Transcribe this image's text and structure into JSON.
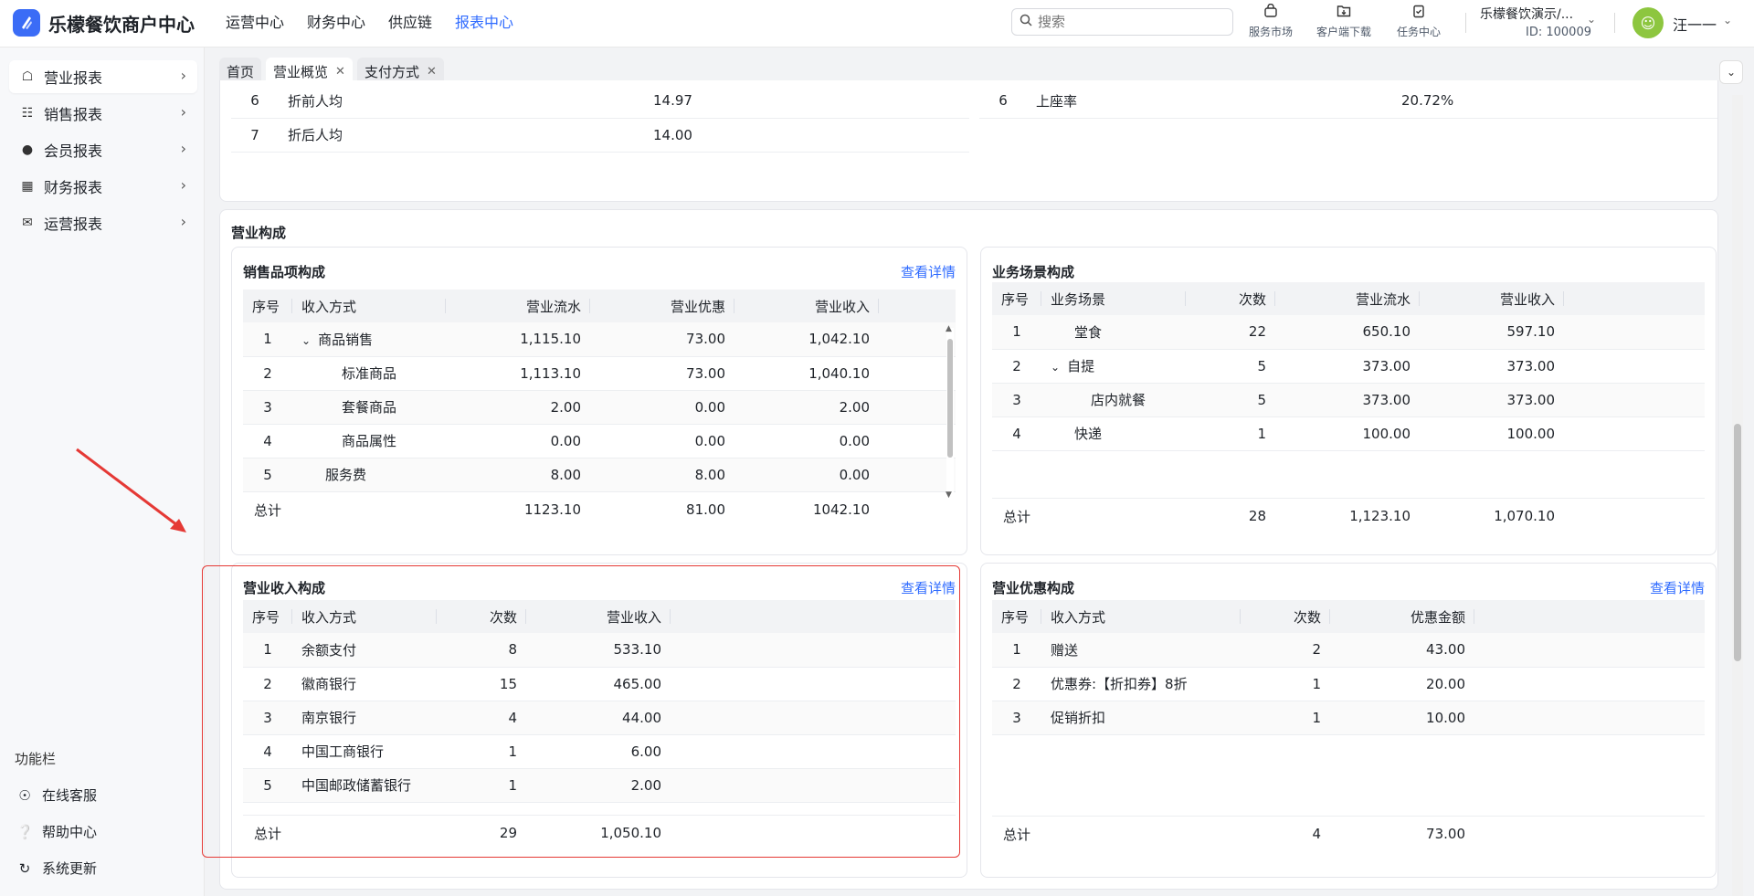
{
  "header": {
    "brand": "乐檬餐饮商户中心",
    "nav": [
      {
        "label": "运营中心",
        "active": false
      },
      {
        "label": "财务中心",
        "active": false
      },
      {
        "label": "供应链",
        "active": false
      },
      {
        "label": "报表中心",
        "active": true
      }
    ],
    "search_placeholder": "搜索",
    "tools": [
      {
        "label": "服务市场",
        "icon": "shop-bag-icon"
      },
      {
        "label": "客户端下载",
        "icon": "folder-download-icon"
      },
      {
        "label": "任务中心",
        "icon": "clipboard-check-icon"
      }
    ],
    "store_name": "乐檬餐饮演示/...",
    "store_id": "ID: 100009",
    "user_name": "汪一一"
  },
  "sidebar": {
    "items": [
      {
        "label": "营业报表",
        "icon": "store-icon",
        "active": true
      },
      {
        "label": "销售报表",
        "icon": "bank-icon",
        "active": false
      },
      {
        "label": "会员报表",
        "icon": "user-icon",
        "active": false
      },
      {
        "label": "财务报表",
        "icon": "finance-icon",
        "active": false
      },
      {
        "label": "运营报表",
        "icon": "operation-icon",
        "active": false
      }
    ],
    "func_title": "功能栏",
    "func_items": [
      {
        "label": "在线客服",
        "icon": "headset-icon"
      },
      {
        "label": "帮助中心",
        "icon": "help-icon"
      },
      {
        "label": "系统更新",
        "icon": "refresh-icon"
      }
    ]
  },
  "tabs": [
    {
      "label": "首页",
      "closable": false,
      "active": false
    },
    {
      "label": "营业概览",
      "closable": true,
      "active": true
    },
    {
      "label": "支付方式",
      "closable": true,
      "active": false
    }
  ],
  "top_left_rows": [
    {
      "no": "6",
      "name": "折前人均",
      "value": "14.97"
    },
    {
      "no": "7",
      "name": "折后人均",
      "value": "14.00"
    }
  ],
  "top_right_rows": [
    {
      "no": "6",
      "name": "上座率",
      "value": "20.72%"
    }
  ],
  "composition": {
    "title": "营业构成",
    "sales": {
      "title": "销售品项构成",
      "link": "查看详情",
      "headers": [
        "序号",
        "收入方式",
        "营业流水",
        "营业优惠",
        "营业收入"
      ],
      "rows": [
        {
          "no": "1",
          "name": "商品销售",
          "flow": "1,115.10",
          "disc": "73.00",
          "income": "1,042.10",
          "indent": 1,
          "expand": true
        },
        {
          "no": "2",
          "name": "标准商品",
          "flow": "1,113.10",
          "disc": "73.00",
          "income": "1,040.10",
          "indent": 2
        },
        {
          "no": "3",
          "name": "套餐商品",
          "flow": "2.00",
          "disc": "0.00",
          "income": "2.00",
          "indent": 2
        },
        {
          "no": "4",
          "name": "商品属性",
          "flow": "0.00",
          "disc": "0.00",
          "income": "0.00",
          "indent": 2
        },
        {
          "no": "5",
          "name": "服务费",
          "flow": "8.00",
          "disc": "8.00",
          "income": "0.00",
          "indent": 1
        }
      ],
      "total": {
        "label": "总计",
        "flow": "1123.10",
        "disc": "81.00",
        "income": "1042.10"
      }
    },
    "scene": {
      "title": "业务场景构成",
      "headers": [
        "序号",
        "业务场景",
        "次数",
        "营业流水",
        "营业收入"
      ],
      "rows": [
        {
          "no": "1",
          "name": "堂食",
          "count": "22",
          "flow": "650.10",
          "income": "597.10",
          "indent": 1
        },
        {
          "no": "2",
          "name": "自提",
          "count": "5",
          "flow": "373.00",
          "income": "373.00",
          "indent": 1,
          "expand": true
        },
        {
          "no": "3",
          "name": "店内就餐",
          "count": "5",
          "flow": "373.00",
          "income": "373.00",
          "indent": 2
        },
        {
          "no": "4",
          "name": "快递",
          "count": "1",
          "flow": "100.00",
          "income": "100.00",
          "indent": 1
        }
      ],
      "total": {
        "label": "总计",
        "count": "28",
        "flow": "1,123.10",
        "income": "1,070.10"
      }
    },
    "income": {
      "title": "营业收入构成",
      "link": "查看详情",
      "headers": [
        "序号",
        "收入方式",
        "次数",
        "营业收入"
      ],
      "rows": [
        {
          "no": "1",
          "name": "余额支付",
          "count": "8",
          "income": "533.10"
        },
        {
          "no": "2",
          "name": "徽商银行",
          "count": "15",
          "income": "465.00"
        },
        {
          "no": "3",
          "name": "南京银行",
          "count": "4",
          "income": "44.00"
        },
        {
          "no": "4",
          "name": "中国工商银行",
          "count": "1",
          "income": "6.00"
        },
        {
          "no": "5",
          "name": "中国邮政储蓄银行",
          "count": "1",
          "income": "2.00"
        }
      ],
      "total": {
        "label": "总计",
        "count": "29",
        "income": "1,050.10"
      }
    },
    "discount": {
      "title": "营业优惠构成",
      "link": "查看详情",
      "headers": [
        "序号",
        "收入方式",
        "次数",
        "优惠金额"
      ],
      "rows": [
        {
          "no": "1",
          "name": "赠送",
          "count": "2",
          "amount": "43.00"
        },
        {
          "no": "2",
          "name": "优惠券:【折扣券】8折",
          "count": "1",
          "amount": "20.00"
        },
        {
          "no": "3",
          "name": "促销折扣",
          "count": "1",
          "amount": "10.00"
        }
      ],
      "total": {
        "label": "总计",
        "count": "4",
        "amount": "73.00"
      }
    }
  },
  "colors": {
    "accent": "#2f6bff",
    "highlight": "#e53935"
  }
}
